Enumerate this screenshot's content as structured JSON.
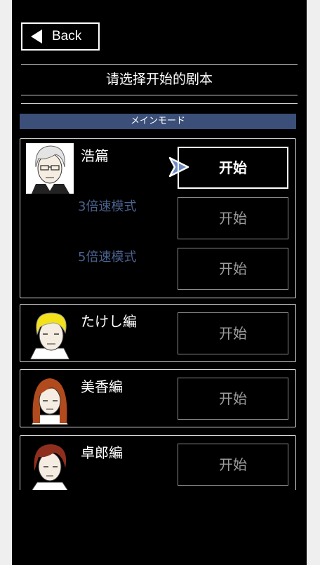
{
  "header": {
    "back_label": "Back",
    "title": "请选择开始的剧本"
  },
  "mode_bar": {
    "label": "メインモード"
  },
  "scenarios": [
    {
      "name": "浩篇",
      "start_label": "开始",
      "hair_color": "#e4e4e4",
      "speeds": [
        {
          "label": "3倍速模式",
          "start_label": "开始"
        },
        {
          "label": "5倍速模式",
          "start_label": "开始"
        }
      ]
    },
    {
      "name": "たけし編",
      "start_label": "开始",
      "hair_color": "#f3e21a"
    },
    {
      "name": "美香編",
      "start_label": "开始",
      "hair_color": "#b14a1c"
    },
    {
      "name": "卓郎編",
      "start_label": "开始",
      "hair_color": "#8e2f1e"
    }
  ],
  "colors": {
    "mode_bar": "#3b4f78",
    "speed_text": "#4a6290",
    "cursor": "#6d8bc4"
  }
}
